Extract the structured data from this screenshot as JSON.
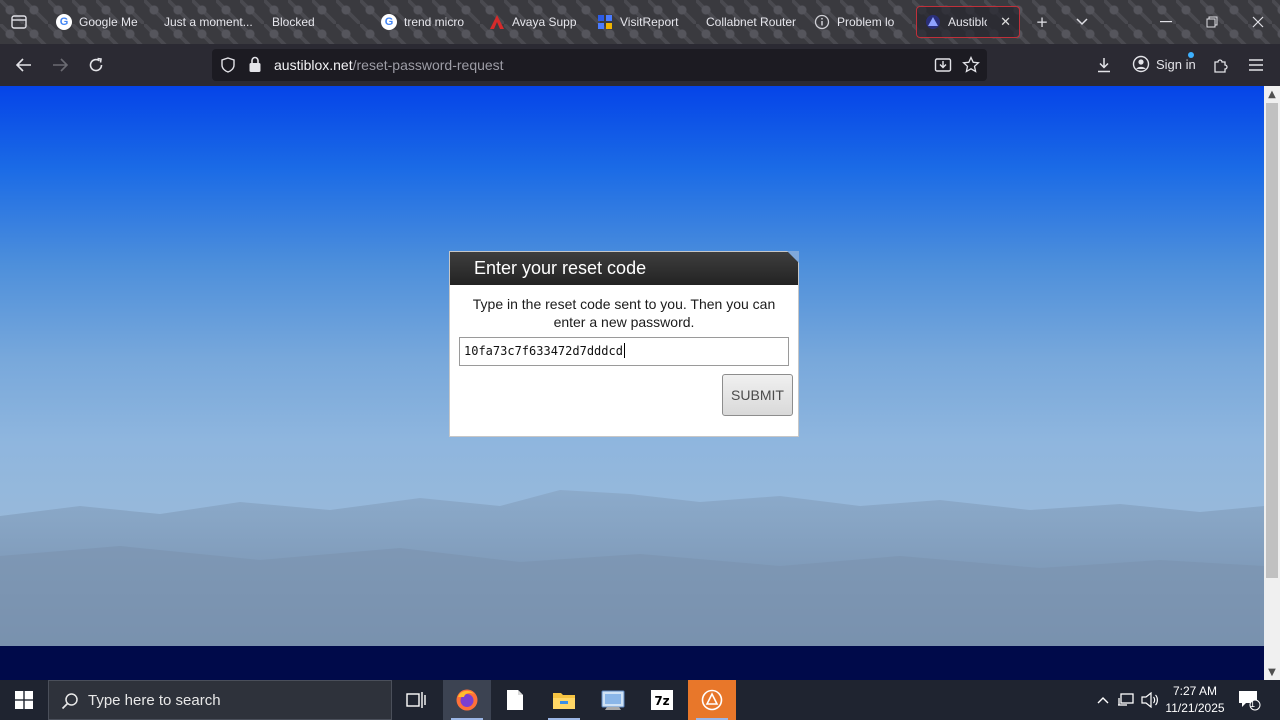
{
  "browser": {
    "tabs": [
      {
        "title": "Google Me",
        "favicon": "google-g-icon",
        "favicon_color": "#4285f4"
      },
      {
        "title": "Just a moment...",
        "favicon": "",
        "favicon_color": ""
      },
      {
        "title": "Blocked",
        "favicon": "",
        "favicon_color": ""
      },
      {
        "title": "trend micro",
        "favicon": "google-g-icon",
        "favicon_color": "#4285f4"
      },
      {
        "title": "Avaya Supp",
        "favicon": "avaya-icon",
        "favicon_color": "#d42b2b"
      },
      {
        "title": "VisitReport",
        "favicon": "visitreport-icon",
        "favicon_color": "#2c5be6"
      },
      {
        "title": "Collabnet Router",
        "favicon": "",
        "favicon_color": ""
      },
      {
        "title": "Problem lo",
        "favicon": "info-icon",
        "favicon_color": "#cfcfcf"
      },
      {
        "title": "Austiblox",
        "favicon": "austiblox-icon",
        "favicon_color": "#6d7fe0",
        "active": true
      }
    ],
    "url": {
      "host": "austiblox.net",
      "path": "/reset-password-request"
    },
    "signin_label": "Sign in"
  },
  "dialog": {
    "title": "Enter your reset code",
    "message": "Type in the reset code sent to you. Then you can enter a new password.",
    "code_value": "10fa73c7f633472d7dddcd",
    "submit_label": "SUBMIT"
  },
  "taskbar": {
    "search_placeholder": "Type here to search",
    "time": "7:27 AM",
    "date": "11/21/2025",
    "notification_count": "1",
    "apps": [
      "task-view-icon",
      "firefox-icon",
      "notepad-icon",
      "file-explorer-icon",
      "control-panel-icon",
      "7zip-icon",
      "app-icon"
    ]
  },
  "colors": {
    "sky_top": "#0544e8",
    "sky_bottom": "#8fb6de",
    "dialog_header": "#2b2b2b",
    "active_tab_border": "#c0303a"
  }
}
